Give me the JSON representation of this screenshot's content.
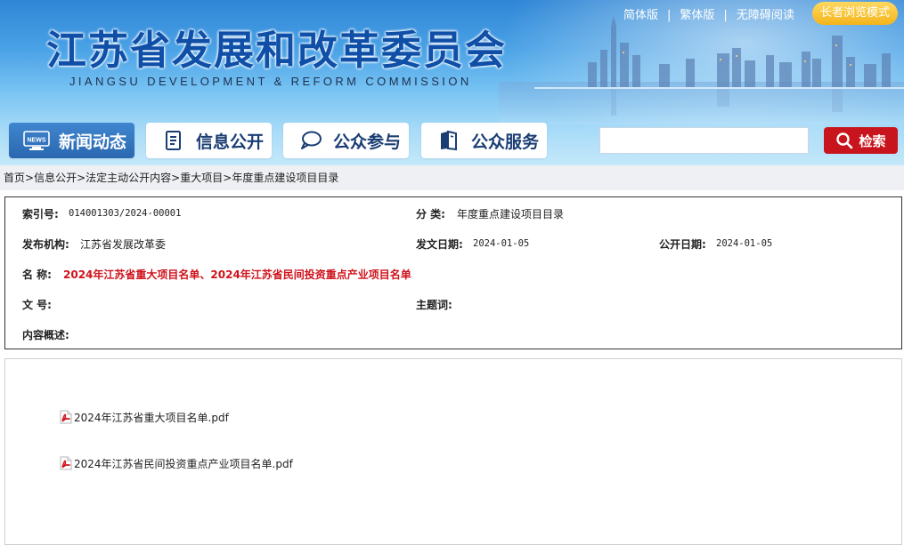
{
  "header": {
    "site_title": "江苏省发展和改革委员会",
    "site_subtitle": "JIANGSU DEVELOPMENT & REFORM COMMISSION",
    "top_links": [
      "简体版",
      "繁体版",
      "无障碍阅读"
    ],
    "separator": "|",
    "elder_mode": "长者浏览模式"
  },
  "nav": {
    "items": [
      {
        "label": "新闻动态",
        "icon": "news-icon",
        "active": true
      },
      {
        "label": "信息公开",
        "icon": "document-icon",
        "active": false
      },
      {
        "label": "公众参与",
        "icon": "chat-bubble-icon",
        "active": false
      },
      {
        "label": "公众服务",
        "icon": "book-icon",
        "active": false
      }
    ],
    "search_placeholder": "",
    "search_button": "检索",
    "news_icon_text": "NEWS"
  },
  "breadcrumb": {
    "items": [
      "首页",
      "信息公开",
      "法定主动公开内容",
      "重大项目",
      "年度重点建设项目目录"
    ],
    "separator": ">"
  },
  "info": {
    "index_label": "索引号:",
    "index_value": "014001303/2024-00001",
    "category_label": "分 类:",
    "category_value": "年度重点建设项目目录",
    "publisher_label": "发布机构:",
    "publisher_value": "江苏省发展改革委",
    "issue_date_label": "发文日期:",
    "issue_date_value": "2024-01-05",
    "public_date_label": "公开日期:",
    "public_date_value": "2024-01-05",
    "name_label": "名 称:",
    "name_value": "2024年江苏省重大项目名单、2024年江苏省民间投资重点产业项目名单",
    "doc_no_label": "文 号:",
    "doc_no_value": "",
    "keywords_label": "主题词:",
    "keywords_value": "",
    "summary_label": "内容概述:",
    "summary_value": ""
  },
  "attachments": [
    {
      "name": "2024年江苏省重大项目名单.pdf",
      "icon": "pdf-icon"
    },
    {
      "name": "2024年江苏省民间投资重点产业项目名单.pdf",
      "icon": "pdf-icon"
    }
  ],
  "colors": {
    "accent_red": "#c8151d",
    "title_blue": "#0f4fa8",
    "nav_active": "#2a68b0",
    "elder_gold": "#f4b41a"
  }
}
